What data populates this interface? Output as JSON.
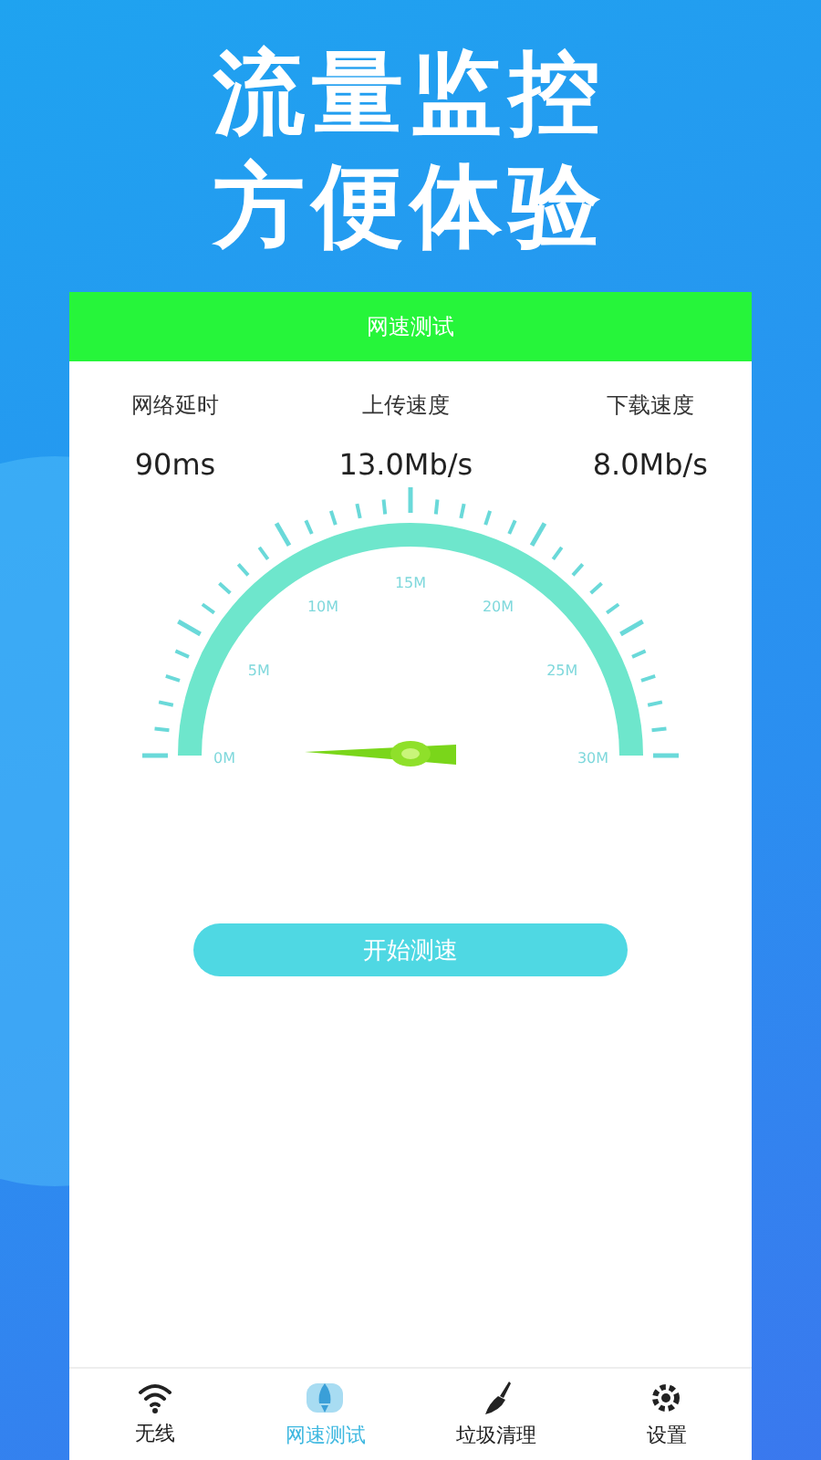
{
  "headline": [
    "流量监控",
    "方便体验"
  ],
  "header": {
    "title": "网速测试"
  },
  "stats": [
    {
      "label": "网络延时",
      "value": "90ms"
    },
    {
      "label": "上传速度",
      "value": "13.0Mb/s"
    },
    {
      "label": "下载速度",
      "value": "8.0Mb/s"
    }
  ],
  "gauge": {
    "labels": [
      "0M",
      "5M",
      "10M",
      "15M",
      "20M",
      "25M",
      "30M"
    ]
  },
  "start_button": "开始测速",
  "tabs": [
    {
      "label": "无线",
      "kind": "wifi",
      "selected": false
    },
    {
      "label": "网速测试",
      "kind": "rocket",
      "selected": true
    },
    {
      "label": "垃圾清理",
      "kind": "broom",
      "selected": false
    },
    {
      "label": "设置",
      "kind": "gear",
      "selected": false
    }
  ]
}
